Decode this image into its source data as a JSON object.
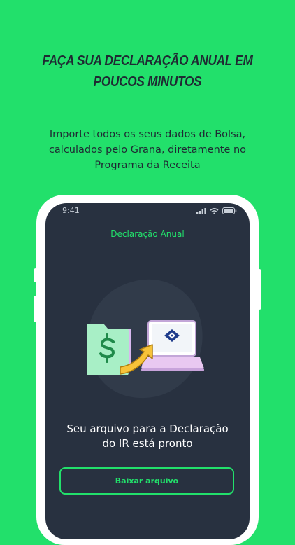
{
  "headline": {
    "line1": "FAÇA SUA DECLARAÇÃO ANUAL EM",
    "line2": "POUCOS MINUTOS"
  },
  "subtitle": {
    "line1": "Importe todos os seus dados de Bolsa,",
    "line2": "calculados pelo Grana, diretamente no",
    "line3": "Programa da Receita"
  },
  "phone": {
    "status": {
      "time": "9:41",
      "icons": [
        "signal-icon",
        "wifi-icon",
        "battery-icon"
      ]
    },
    "screen_title": "Declaração Anual",
    "illustration": {
      "folder_icon": "dollar-folder-icon",
      "arrow_icon": "curved-arrow-icon",
      "laptop_icon": "laptop-receita-icon"
    },
    "message": {
      "line1": "Seu arquivo para a Declaração",
      "line2": "do IR está pronto"
    },
    "download_button": "Baixar arquivo"
  },
  "colors": {
    "background": "#22e06b",
    "accent": "#22e06b",
    "screen": "#283140",
    "text_dark": "#1f2a33",
    "folder": "#a8efc6",
    "arrow": "#f7c33a",
    "laptop": "#e9c8f1"
  }
}
